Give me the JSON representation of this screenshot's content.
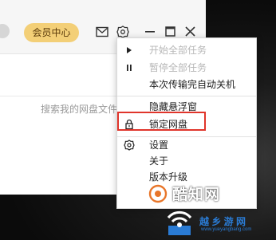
{
  "header": {
    "vip_label": "会员中心",
    "icons": [
      "heart-icon",
      "mail-icon",
      "gear-icon",
      "minimize-icon",
      "maximize-icon",
      "close-icon"
    ]
  },
  "search": {
    "hint": "搜索我的网盘文件"
  },
  "menu": {
    "items": [
      {
        "label": "开始全部任务",
        "icon": "play-icon",
        "disabled": true
      },
      {
        "label": "暂停全部任务",
        "icon": "pause-icon",
        "disabled": true
      },
      {
        "label": "本次传输完自动关机",
        "icon": "",
        "disabled": false
      },
      {
        "label": "隐藏悬浮窗",
        "icon": "",
        "disabled": false
      },
      {
        "label": "锁定网盘",
        "icon": "lock-icon",
        "disabled": false,
        "highlighted": true
      },
      {
        "label": "设置",
        "icon": "gear-icon",
        "disabled": false
      },
      {
        "label": "关于",
        "icon": "",
        "disabled": false
      },
      {
        "label": "版本升级",
        "icon": "",
        "disabled": false
      }
    ]
  },
  "watermark": {
    "brand1": "酷知网",
    "brand2": "越 乡 游 网",
    "url2": "www.yueyangbang.com"
  },
  "colors": {
    "vip_bg": "#f3cf77",
    "highlight": "#e0352b",
    "disabled_text": "#b7b7b7"
  }
}
